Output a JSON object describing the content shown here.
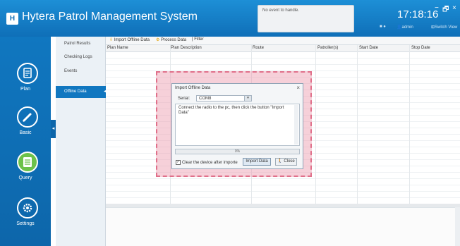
{
  "app": {
    "logo_text": "H",
    "title": "Hytera Patrol Management System",
    "event_text": "No event to handle.",
    "clock": "17:18:16",
    "user": "admin",
    "switch_view": "Switch View",
    "win_minimize": "−",
    "win_restore": "🗗",
    "win_close": "×"
  },
  "sidebar": {
    "items": [
      {
        "label": "Plan",
        "icon": "document-icon"
      },
      {
        "label": "Basic",
        "icon": "pencil-icon"
      },
      {
        "label": "Query",
        "icon": "report-icon"
      },
      {
        "label": "Settings",
        "icon": "gear-icon"
      }
    ],
    "collapse": "◂",
    "active": "Query"
  },
  "subnav": {
    "items": [
      "Patrol Results",
      "Checking Logs",
      "Events",
      "Offline Data"
    ],
    "active_arrow": "◂"
  },
  "toolbar": {
    "import_offline": "Import Offline Data",
    "process_data": "Process Data",
    "filter": "Filter"
  },
  "table": {
    "columns": [
      "Plan Name",
      "Plan Description",
      "Route",
      "Patroller(s)",
      "Start Date",
      "Stop Date"
    ]
  },
  "dialog": {
    "title": "Import Offline Data",
    "close": "×",
    "serial_label": "Serial:",
    "serial_value": "COM8",
    "select_arrow": "▾",
    "message": "Connect the radio to the pc, then click the button \"Import Data\"",
    "progress": "0%",
    "clear_checkbox_label": "Clear the device after importe",
    "clear_checked": true,
    "check_mark": "✓",
    "import_button": "Import Data",
    "close_button": "Close"
  },
  "colors": {
    "titlebar": "#1177c2",
    "active_nav": "#6cc24a",
    "highlight_overlay": "#ec96aa"
  }
}
